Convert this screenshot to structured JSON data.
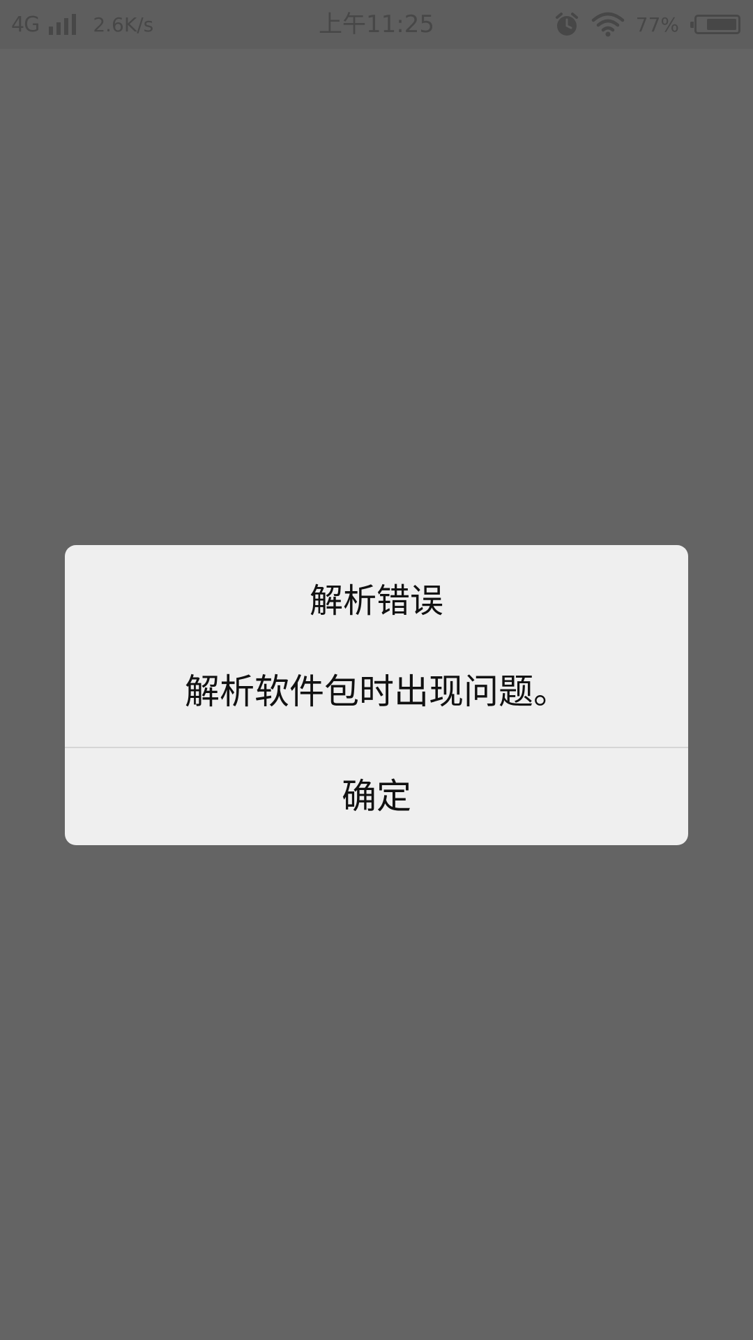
{
  "status_bar": {
    "network": "4G",
    "speed": "2.6K/s",
    "time": "上午11:25",
    "battery_percent_text": "77%",
    "battery_level": 0.77,
    "icons": [
      "signal-icon",
      "alarm-icon",
      "wifi-icon",
      "battery-icon"
    ]
  },
  "dialog": {
    "title": "解析错误",
    "message": "解析软件包时出现问题。",
    "ok_label": "确定"
  },
  "colors": {
    "scrim": "#646464",
    "dialog_bg": "#efefef",
    "text": "#111111"
  }
}
